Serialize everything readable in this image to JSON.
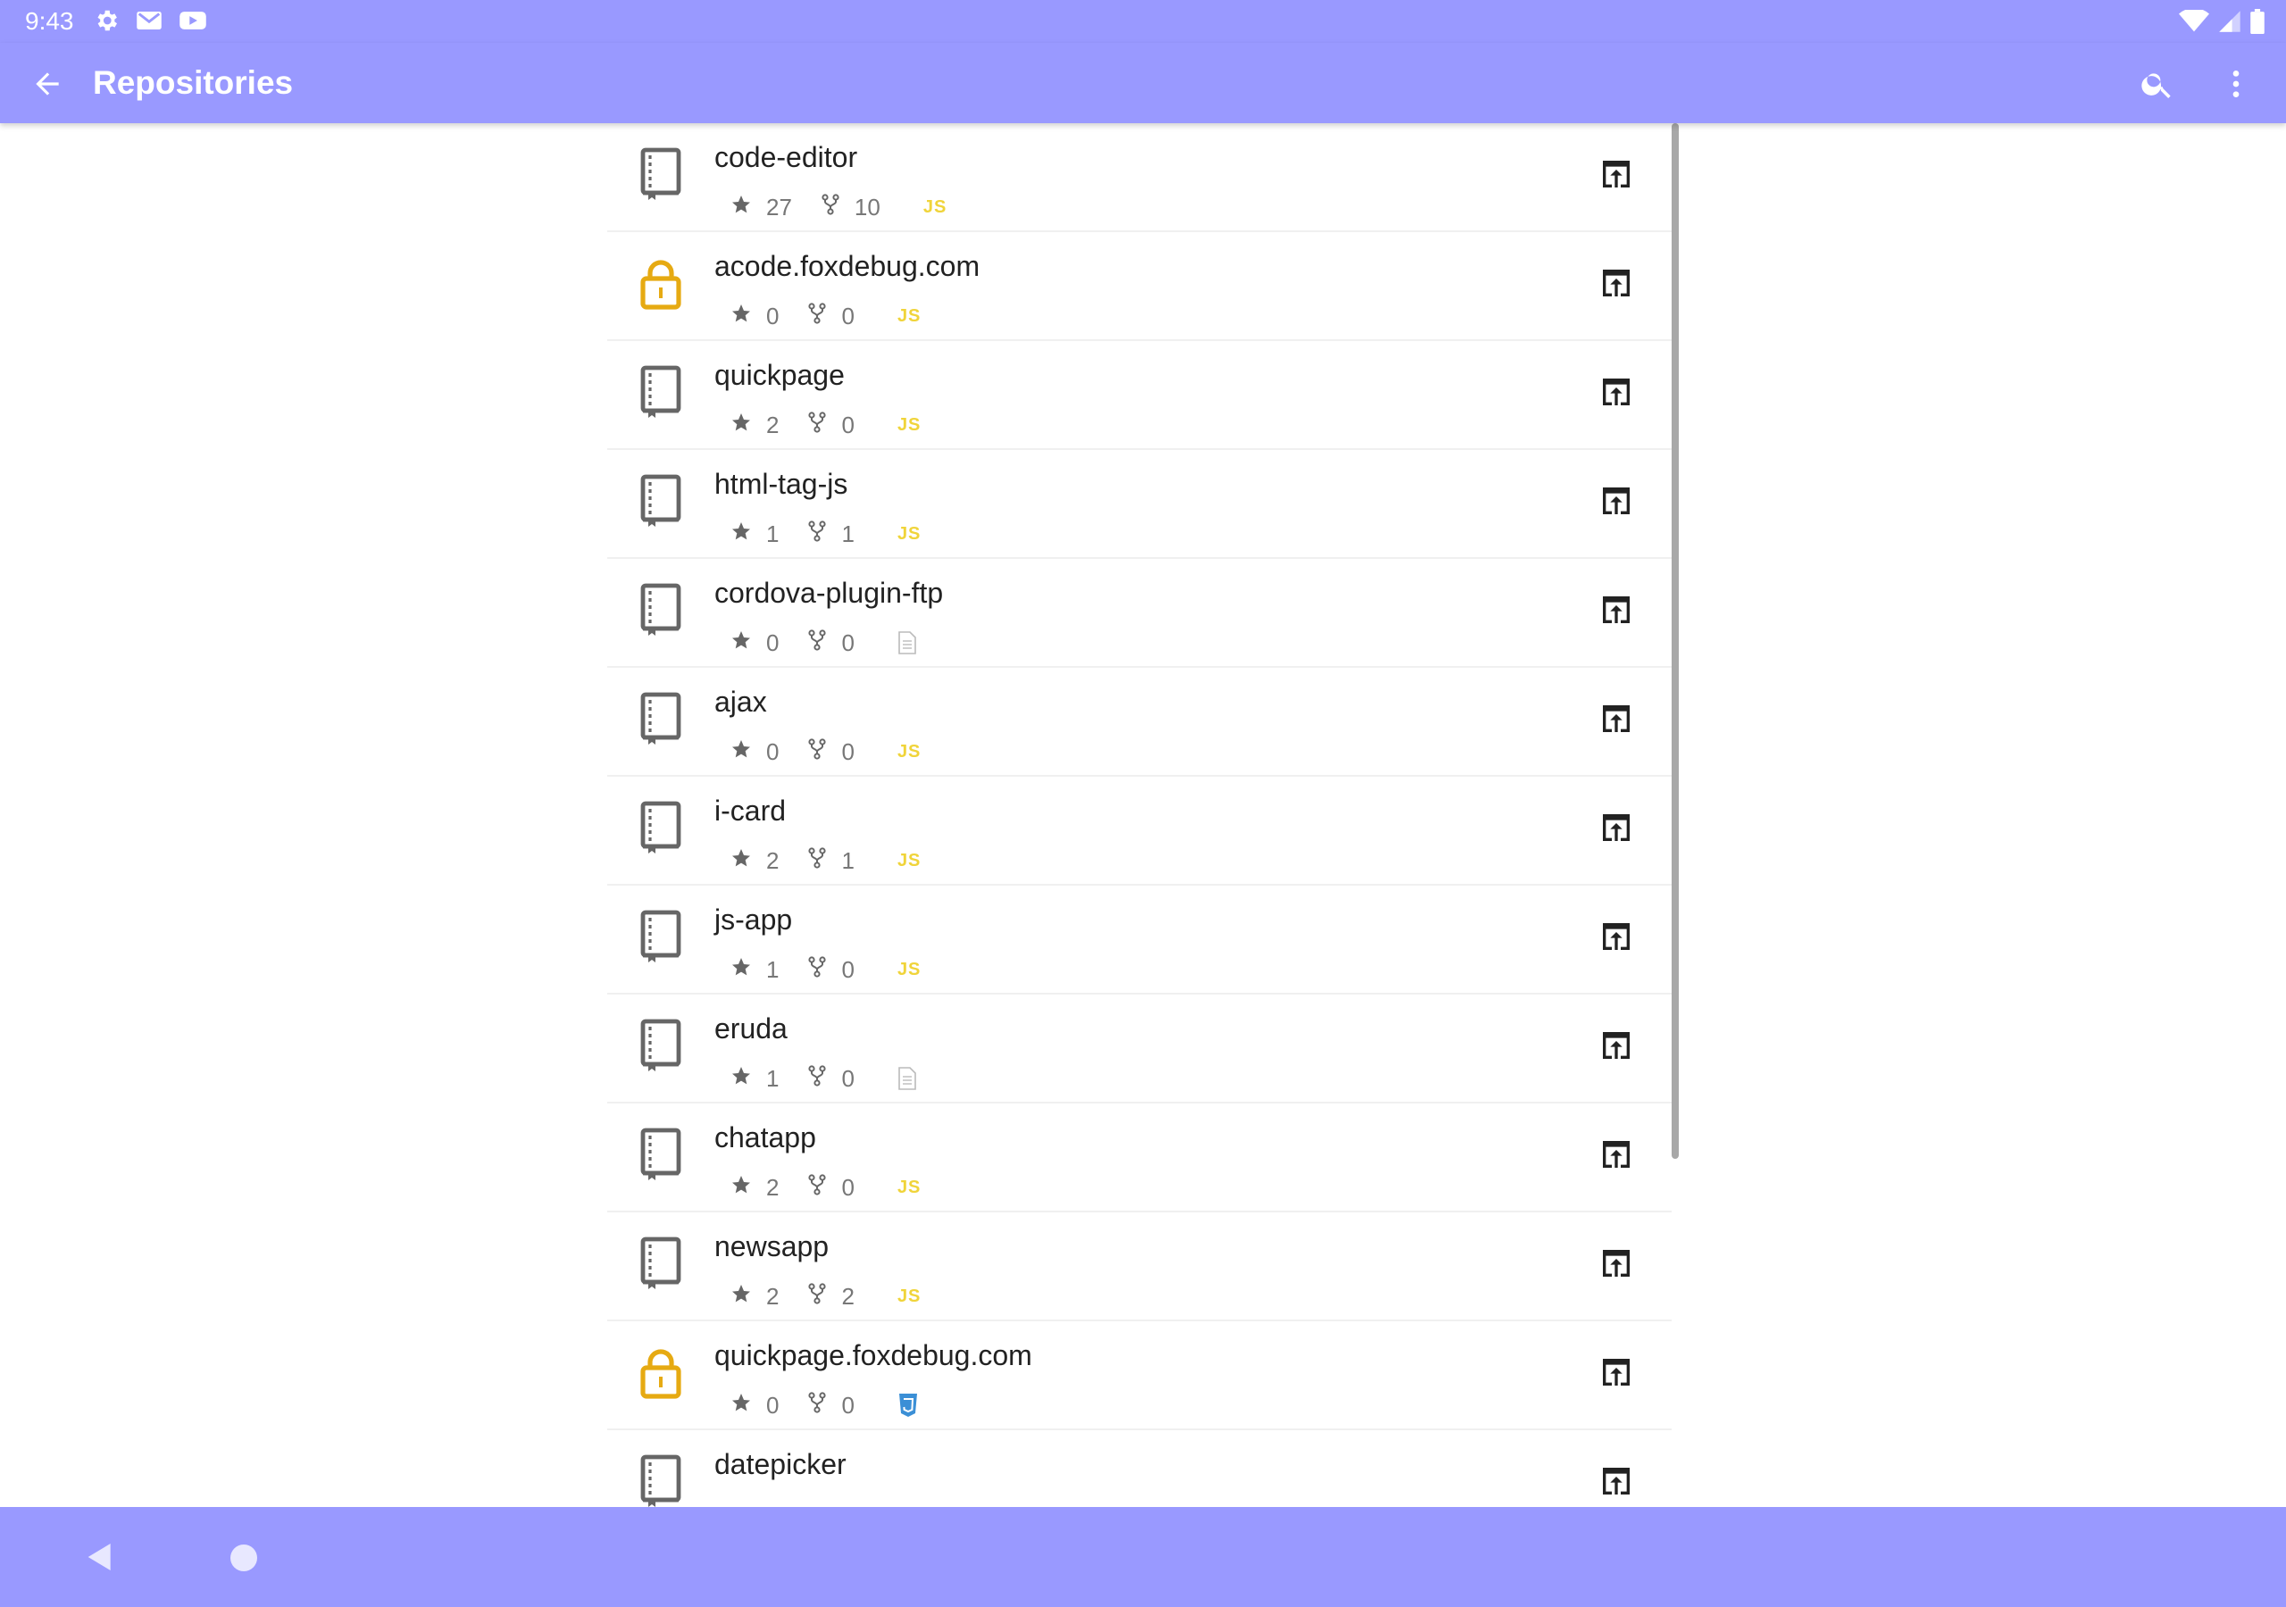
{
  "status_bar": {
    "time": "9:43",
    "left_icons": [
      "settings-icon",
      "gmail-icon",
      "youtube-icon"
    ],
    "right_icons": [
      "wifi-icon",
      "signal-icon",
      "battery-icon"
    ]
  },
  "app_bar": {
    "title": "Repositories",
    "back_icon": "arrow-back-icon",
    "search_icon": "search-icon",
    "menu_icon": "more-vert-icon"
  },
  "colors": {
    "bar": "#9999ff",
    "private_lock": "#e6aa12",
    "js_badge": "#f0d43a",
    "css_badge": "#3b8fd6"
  },
  "repositories": [
    {
      "name": "code-editor",
      "stars": "27",
      "forks": "10",
      "lang": "JS",
      "private": false
    },
    {
      "name": "acode.foxdebug.com",
      "stars": "0",
      "forks": "0",
      "lang": "JS",
      "private": true
    },
    {
      "name": "quickpage",
      "stars": "2",
      "forks": "0",
      "lang": "JS",
      "private": false
    },
    {
      "name": "html-tag-js",
      "stars": "1",
      "forks": "1",
      "lang": "JS",
      "private": false
    },
    {
      "name": "cordova-plugin-ftp",
      "stars": "0",
      "forks": "0",
      "lang": "file",
      "private": false
    },
    {
      "name": "ajax",
      "stars": "0",
      "forks": "0",
      "lang": "JS",
      "private": false
    },
    {
      "name": "i-card",
      "stars": "2",
      "forks": "1",
      "lang": "JS",
      "private": false
    },
    {
      "name": "js-app",
      "stars": "1",
      "forks": "0",
      "lang": "JS",
      "private": false
    },
    {
      "name": "eruda",
      "stars": "1",
      "forks": "0",
      "lang": "file",
      "private": false
    },
    {
      "name": "chatapp",
      "stars": "2",
      "forks": "0",
      "lang": "JS",
      "private": false
    },
    {
      "name": "newsapp",
      "stars": "2",
      "forks": "2",
      "lang": "JS",
      "private": false
    },
    {
      "name": "quickpage.foxdebug.com",
      "stars": "0",
      "forks": "0",
      "lang": "CSS",
      "private": true
    },
    {
      "name": "datepicker",
      "stars": "",
      "forks": "",
      "lang": "",
      "private": false
    }
  ],
  "nav_bar": {
    "icons": [
      "nav-back-icon",
      "nav-home-icon"
    ]
  }
}
